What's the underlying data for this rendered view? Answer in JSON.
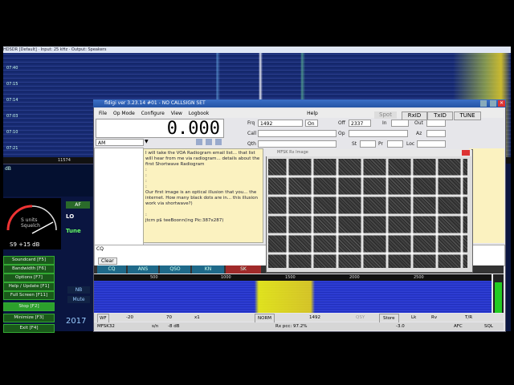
{
  "sdr": {
    "title": "HDSDR [Default] · Input: 25 kHz · Output: Speakers",
    "wf_times": [
      "07:40",
      "07:15",
      "07:14",
      "07:03",
      "07:10",
      "07:21"
    ],
    "freq_marker": "11574",
    "db_label": "dB",
    "smeter_label": "S units\nSquelch",
    "smeter_value": "S9 +15 dB",
    "lo_label": "LO",
    "tune_label": "Tune",
    "af_label": "AF",
    "buttons": [
      "Soundcard [F5]",
      "Bandwidth [F6]",
      "Options [F7]",
      "Help / Update [F1]",
      "Full Screen [F11]",
      "Stop [F2]",
      "Minimize [F3]",
      "Exit [F4]"
    ],
    "nb_label": "NB",
    "mute_label": "Mute",
    "year": "2017"
  },
  "fldigi": {
    "title": "fldigi ver 3.23.14 #01 - NO CALLSIGN SET",
    "menu": [
      "File",
      "Op Mode",
      "Configure",
      "View",
      "Logbook",
      "Help"
    ],
    "frequency": "0.000",
    "mode": "AM",
    "frq": "1492",
    "on_label": "On",
    "off_label": "Off",
    "off_value": "2337",
    "in_label": "In",
    "out_label": "Out",
    "call_label": "Call",
    "op_label": "Op",
    "az_label": "Az",
    "qth_label": "Qth",
    "st_label": "St",
    "pr_label": "Pr",
    "loc_label": "Loc",
    "spot_label": "Spot",
    "rxid_label": "RxID",
    "txid_label": "TxID",
    "tune_label": "TUNE",
    "rx_text": "I will take the VOA Radiogram email list... that list will hear from me via radiogram... details about the first Shortwave Radiogram\n:\n:\n:\n:\nOur first image is an optical illusion that you... the internet. How many black dots are in... this illusion work via shortwave?)\n\n:\njtcm p$ teeBoonn(ing Pic:387x287)",
    "tx_label": "CQ",
    "clear_label": "Clear",
    "macros": [
      "CQ",
      "ANS",
      "QSO",
      "KN",
      "SK"
    ],
    "ruler": [
      "500",
      "1000",
      "1500",
      "2000",
      "2500"
    ],
    "ctrl": {
      "wf": "WF",
      "wf_v1": "-20",
      "wf_v2": "70",
      "zoom": "x1",
      "norm": "NORM",
      "fcenter": "1492",
      "qsy": "QSY",
      "store": "Store",
      "lk": "Lk",
      "rv": "Rv",
      "tr": "T/R",
      "level": "-3.0"
    },
    "status": {
      "mode": "MFSK32",
      "sn": "s/n",
      "sn_val": "-8 dB",
      "rx": "Rx pcc: 97.2%",
      "afc": "AFC",
      "sql": "SQL"
    }
  },
  "popup": {
    "title": "MFSK Rx Image"
  }
}
